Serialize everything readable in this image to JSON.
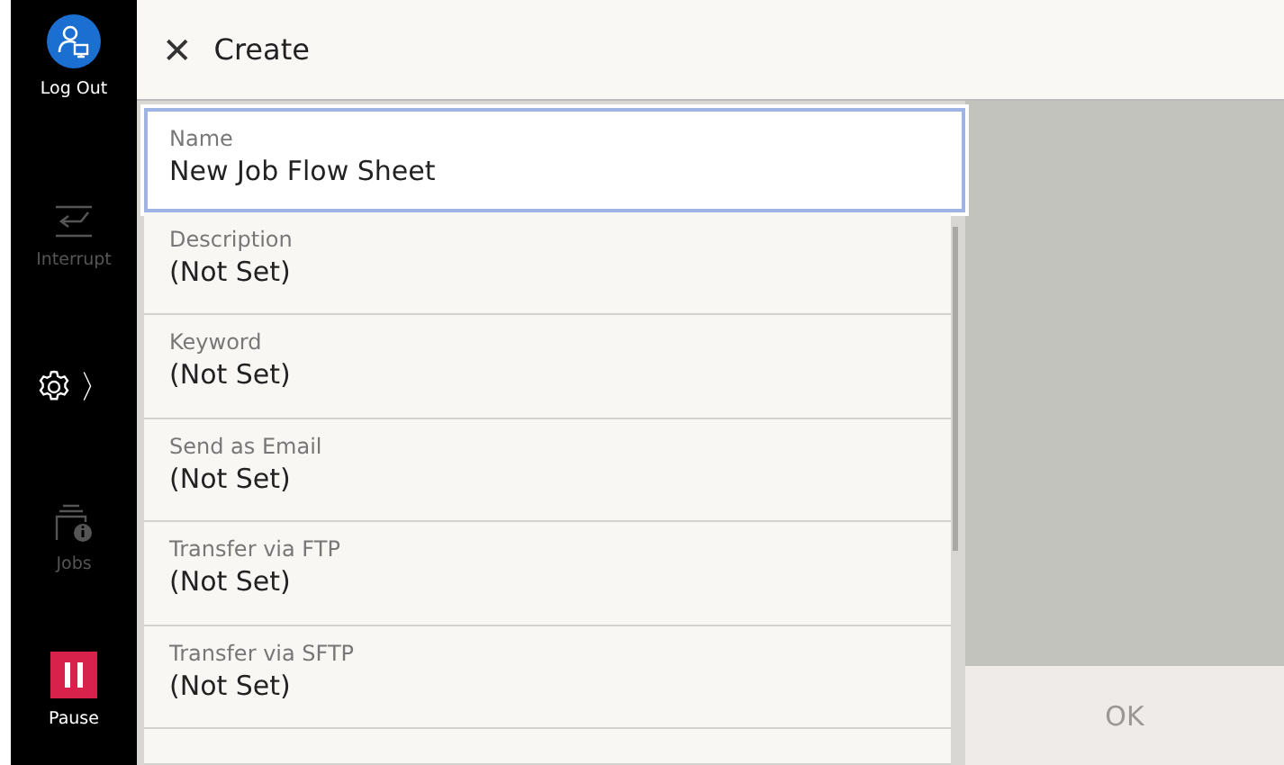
{
  "sidebar": {
    "items": [
      {
        "kind": "logout",
        "label": "Log Out",
        "disabled": false
      },
      {
        "kind": "interrupt",
        "label": "Interrupt",
        "disabled": true
      },
      {
        "kind": "settings",
        "label": "〉",
        "disabled": false
      },
      {
        "kind": "jobs",
        "label": "Jobs",
        "disabled": true
      },
      {
        "kind": "pause",
        "label": "Pause",
        "disabled": false
      }
    ]
  },
  "header": {
    "close_glyph": "✕",
    "title": "Create"
  },
  "fields": [
    {
      "label": "Name",
      "value": "New Job Flow Sheet",
      "selected": true
    },
    {
      "label": "Description",
      "value": "(Not Set)",
      "selected": false
    },
    {
      "label": "Keyword",
      "value": "(Not Set)",
      "selected": false
    },
    {
      "label": "Send as Email",
      "value": "(Not Set)",
      "selected": false
    },
    {
      "label": "Transfer via FTP",
      "value": "(Not Set)",
      "selected": false
    },
    {
      "label": "Transfer via SFTP",
      "value": "(Not Set)",
      "selected": false
    }
  ],
  "ok_button": {
    "label": "OK",
    "disabled": true
  }
}
